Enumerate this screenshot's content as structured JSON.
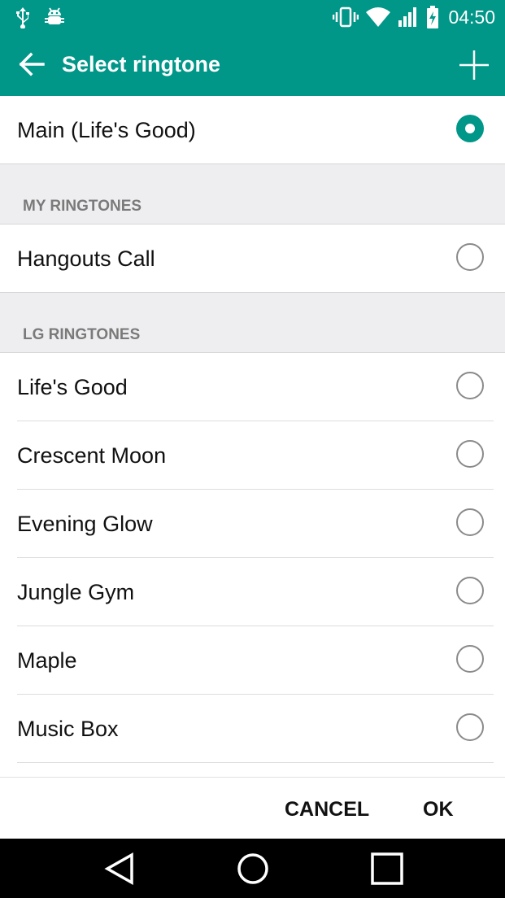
{
  "status_bar": {
    "time": "04:50",
    "icons": [
      "usb-icon",
      "android-debug-icon",
      "vibrate-icon",
      "wifi-icon",
      "signal-icon",
      "battery-charging-icon"
    ]
  },
  "app_bar": {
    "title": "Select ringtone",
    "back_icon": "arrow-left-icon",
    "add_icon": "plus-icon"
  },
  "selected": {
    "label": "Main (Life's Good)",
    "checked": true
  },
  "sections": [
    {
      "header": "MY RINGTONES",
      "items": [
        {
          "label": "Hangouts Call",
          "checked": false
        }
      ]
    },
    {
      "header": "LG RINGTONES",
      "items": [
        {
          "label": "Life's Good",
          "checked": false
        },
        {
          "label": "Crescent Moon",
          "checked": false
        },
        {
          "label": "Evening Glow",
          "checked": false
        },
        {
          "label": "Jungle Gym",
          "checked": false
        },
        {
          "label": "Maple",
          "checked": false
        },
        {
          "label": "Music Box",
          "checked": false
        }
      ]
    }
  ],
  "footer": {
    "cancel_label": "CANCEL",
    "ok_label": "OK"
  },
  "nav_bar": {
    "icons": [
      "back-triangle-icon",
      "home-circle-icon",
      "recents-square-icon"
    ]
  },
  "colors": {
    "accent": "#009688",
    "section_bg": "#eeeef0"
  }
}
